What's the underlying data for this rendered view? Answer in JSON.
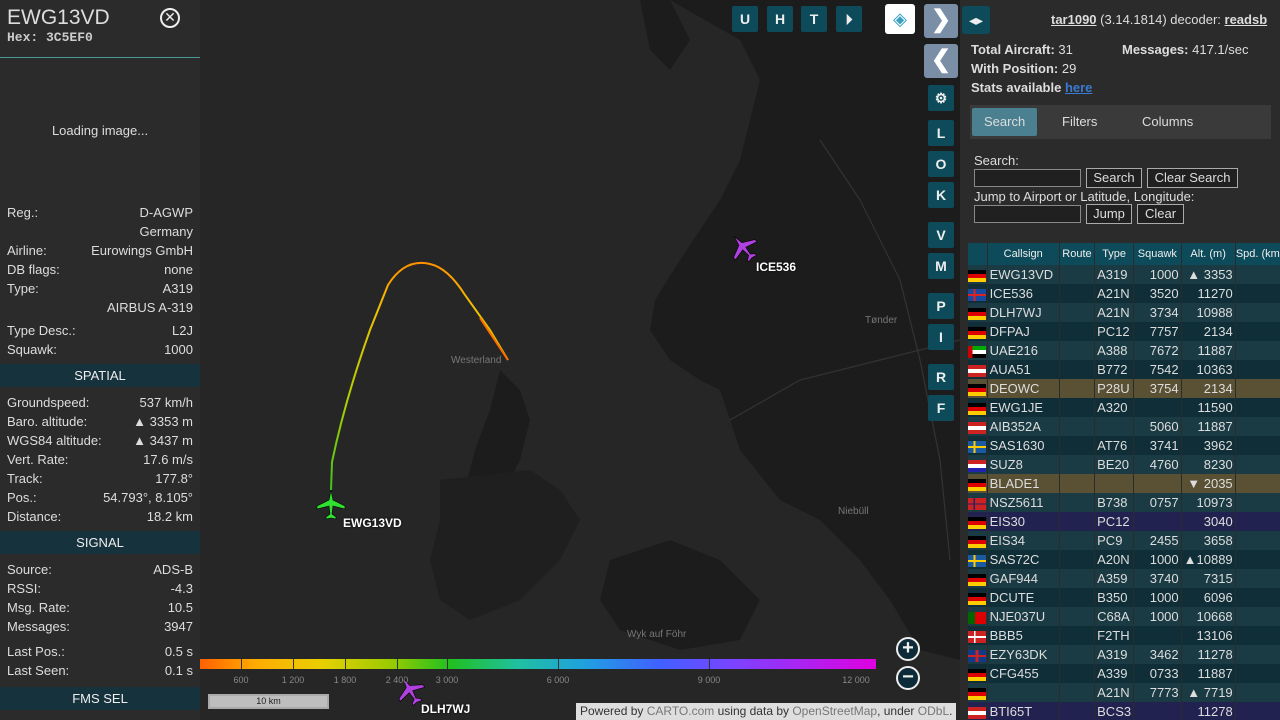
{
  "sidebar": {
    "callsign": "EWG13VD",
    "hex": "Hex: 3C5EF0",
    "image_status": "Loading image...",
    "info": [
      {
        "label": "Reg.:",
        "value": "D-AGWP"
      },
      {
        "label": "",
        "value": "Germany"
      },
      {
        "label": "Airline:",
        "value": "Eurowings GmbH"
      },
      {
        "label": "DB flags:",
        "value": "none"
      },
      {
        "label": "Type:",
        "value": "A319"
      },
      {
        "label": "",
        "value": "AIRBUS A-319"
      }
    ],
    "info2": [
      {
        "label": "Type Desc.:",
        "value": "L2J"
      },
      {
        "label": "Squawk:",
        "value": "1000"
      }
    ],
    "spatial_title": "SPATIAL",
    "spatial": [
      {
        "label": "Groundspeed:",
        "value": "537 km/h"
      },
      {
        "label": "Baro. altitude:",
        "value": "▲ 3353 m"
      },
      {
        "label": "WGS84 altitude:",
        "value": "▲ 3437 m"
      },
      {
        "label": "Vert. Rate:",
        "value": "17.6 m/s"
      },
      {
        "label": "Track:",
        "value": "177.8°"
      },
      {
        "label": "Pos.:",
        "value": "54.793°, 8.105°"
      },
      {
        "label": "Distance:",
        "value": "18.2 km"
      }
    ],
    "signal_title": "SIGNAL",
    "signal": [
      {
        "label": "Source:",
        "value": "ADS-B"
      },
      {
        "label": "RSSI:",
        "value": "-4.3"
      },
      {
        "label": "Msg. Rate:",
        "value": "10.5"
      },
      {
        "label": "Messages:",
        "value": "3947"
      }
    ],
    "signal2": [
      {
        "label": "Last Pos.:",
        "value": "0.5 s"
      },
      {
        "label": "Last Seen:",
        "value": "0.1 s"
      }
    ],
    "fms_title": "FMS SEL"
  },
  "map": {
    "aircraft_labels": [
      "ICE536",
      "EWG13VD",
      "DLH7WJ"
    ],
    "places": [
      "Westerland",
      "Tønder",
      "Niebüll",
      "Wyk auf Föhr"
    ],
    "top_buttons": [
      "U",
      "H",
      "T"
    ],
    "side_buttons": [
      "L",
      "O",
      "K",
      "V",
      "M",
      "P",
      "I",
      "R",
      "F"
    ],
    "altitude_ticks": [
      "600",
      "1 200",
      "1 800",
      "2 400",
      "3 000",
      "6 000",
      "9 000",
      "12 000"
    ],
    "scale": "10 km",
    "attribution": {
      "prefix": "Powered by ",
      "carto": "CARTO.com",
      "mid": " using data by ",
      "osm": "OpenStreetMap",
      "under": ", under ",
      "odbl": "ODbL",
      "suffix": "."
    },
    "zoom_in": "+",
    "zoom_out": "−"
  },
  "panel": {
    "version_name": "tar1090",
    "version_num": "(3.14.1814)",
    "decoder_label": "decoder:",
    "decoder": "readsb",
    "total_label": "Total Aircraft:",
    "total": "31",
    "messages_label": "Messages:",
    "messages": "417.1/sec",
    "withpos_label": "With Position:",
    "withpos": "29",
    "stats_label": "Stats available",
    "stats_link": "here",
    "tabs": [
      "Search",
      "Filters",
      "Columns"
    ],
    "search_label": "Search:",
    "search_btn": "Search",
    "clear_search_btn": "Clear Search",
    "jump_label": "Jump to Airport or Latitude, Longitude:",
    "jump_btn": "Jump",
    "clear_btn": "Clear"
  },
  "table": {
    "columns": [
      "Callsign",
      "Route",
      "Type",
      "Squawk",
      "Alt. (m)",
      "Spd. (km"
    ],
    "rows": [
      {
        "flag": "de",
        "callsign": "EWG13VD",
        "route": "",
        "type": "A319",
        "squawk": "1000",
        "alt": "▲  3353",
        "style": "sel0"
      },
      {
        "flag": "is",
        "callsign": "ICE536",
        "route": "",
        "type": "A21N",
        "squawk": "3520",
        "alt": "11270",
        "style": "alt"
      },
      {
        "flag": "de",
        "callsign": "DLH7WJ",
        "route": "",
        "type": "A21N",
        "squawk": "3734",
        "alt": "10988",
        "style": ""
      },
      {
        "flag": "de",
        "callsign": "DFPAJ",
        "route": "",
        "type": "PC12",
        "squawk": "7757",
        "alt": "2134",
        "style": "alt"
      },
      {
        "flag": "ae",
        "callsign": "UAE216",
        "route": "",
        "type": "A388",
        "squawk": "7672",
        "alt": "11887",
        "style": ""
      },
      {
        "flag": "at",
        "callsign": "AUA51",
        "route": "",
        "type": "B772",
        "squawk": "7542",
        "alt": "10363",
        "style": "alt"
      },
      {
        "flag": "de",
        "callsign": "DEOWC",
        "route": "",
        "type": "P28U",
        "squawk": "3754",
        "alt": "2134",
        "style": "sel"
      },
      {
        "flag": "de",
        "callsign": "EWG1JE",
        "route": "",
        "type": "A320",
        "squawk": "",
        "alt": "11590",
        "style": "alt"
      },
      {
        "flag": "at",
        "callsign": "AIB352A",
        "route": "",
        "type": "",
        "squawk": "5060",
        "alt": "11887",
        "style": ""
      },
      {
        "flag": "se",
        "callsign": "SAS1630",
        "route": "",
        "type": "AT76",
        "squawk": "3741",
        "alt": "3962",
        "style": "alt"
      },
      {
        "flag": "nl",
        "callsign": "SUZ8",
        "route": "",
        "type": "BE20",
        "squawk": "4760",
        "alt": "8230",
        "style": ""
      },
      {
        "flag": "de",
        "callsign": "BLADE1",
        "route": "",
        "type": "",
        "squawk": "",
        "alt": "▼  2035",
        "style": "sel"
      },
      {
        "flag": "no",
        "callsign": "NSZ5611",
        "route": "",
        "type": "B738",
        "squawk": "0757",
        "alt": "10973",
        "style": ""
      },
      {
        "flag": "de",
        "callsign": "EIS30",
        "route": "",
        "type": "PC12",
        "squawk": "",
        "alt": "3040",
        "style": "mil"
      },
      {
        "flag": "de",
        "callsign": "EIS34",
        "route": "",
        "type": "PC9",
        "squawk": "2455",
        "alt": "3658",
        "style": ""
      },
      {
        "flag": "se",
        "callsign": "SAS72C",
        "route": "",
        "type": "A20N",
        "squawk": "1000",
        "alt": "▲10889",
        "style": "alt"
      },
      {
        "flag": "de",
        "callsign": "GAF944",
        "route": "",
        "type": "A359",
        "squawk": "3740",
        "alt": "7315",
        "style": ""
      },
      {
        "flag": "de",
        "callsign": "DCUTE",
        "route": "",
        "type": "B350",
        "squawk": "1000",
        "alt": "6096",
        "style": "alt"
      },
      {
        "flag": "pt",
        "callsign": "NJE037U",
        "route": "",
        "type": "C68A",
        "squawk": "1000",
        "alt": "10668",
        "style": ""
      },
      {
        "flag": "dk",
        "callsign": "BBB5",
        "route": "",
        "type": "F2TH",
        "squawk": "",
        "alt": "13106",
        "style": "alt"
      },
      {
        "flag": "gb",
        "callsign": "EZY63DK",
        "route": "",
        "type": "A319",
        "squawk": "3462",
        "alt": "11278",
        "style": ""
      },
      {
        "flag": "de",
        "callsign": "CFG455",
        "route": "",
        "type": "A339",
        "squawk": "0733",
        "alt": "11887",
        "style": "alt"
      },
      {
        "flag": "de",
        "callsign": "",
        "route": "",
        "type": "A21N",
        "squawk": "7773",
        "alt": "▲  7719",
        "style": ""
      },
      {
        "flag": "at",
        "callsign": "BTI65T",
        "route": "",
        "type": "BCS3",
        "squawk": "",
        "alt": "11278",
        "style": "mil"
      }
    ]
  },
  "colors": {
    "accent": "#0d4a5a",
    "header": "#16323c",
    "selected_row": "#5a5034"
  }
}
